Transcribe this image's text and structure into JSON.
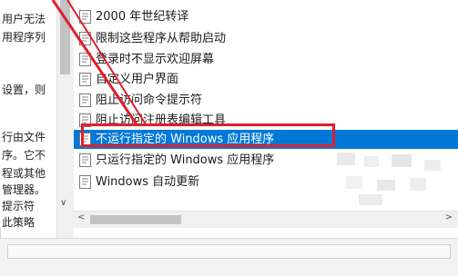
{
  "left_pane": {
    "lines": [
      "用户无法",
      "用程序列",
      "",
      "设置，则",
      "",
      "行由文件",
      "序。它不",
      "程或其他",
      "管理器。",
      "提示符",
      "此策略"
    ]
  },
  "list": {
    "items": [
      {
        "label": "2000 年世纪转译",
        "selected": false
      },
      {
        "label": "限制这些程序从帮助启动",
        "selected": false
      },
      {
        "label": "登录时不显示欢迎屏幕",
        "selected": false
      },
      {
        "label": "自定义用户界面",
        "selected": false
      },
      {
        "label": "阻止访问命令提示符",
        "selected": false
      },
      {
        "label": "阻止访问注册表编辑工具",
        "selected": false
      },
      {
        "label": "不运行指定的 Windows 应用程序",
        "selected": true
      },
      {
        "label": "只运行指定的 Windows 应用程序",
        "selected": false
      },
      {
        "label": "Windows 自动更新",
        "selected": false
      }
    ]
  },
  "icons": {
    "policy_item": "policy-setting-icon",
    "scroll_down": "chevron-down-icon",
    "scroll_left": "chevron-left-icon",
    "scroll_right": "chevron-right-icon"
  },
  "colors": {
    "selection": "#0078d7",
    "annotation": "#e0202a"
  }
}
